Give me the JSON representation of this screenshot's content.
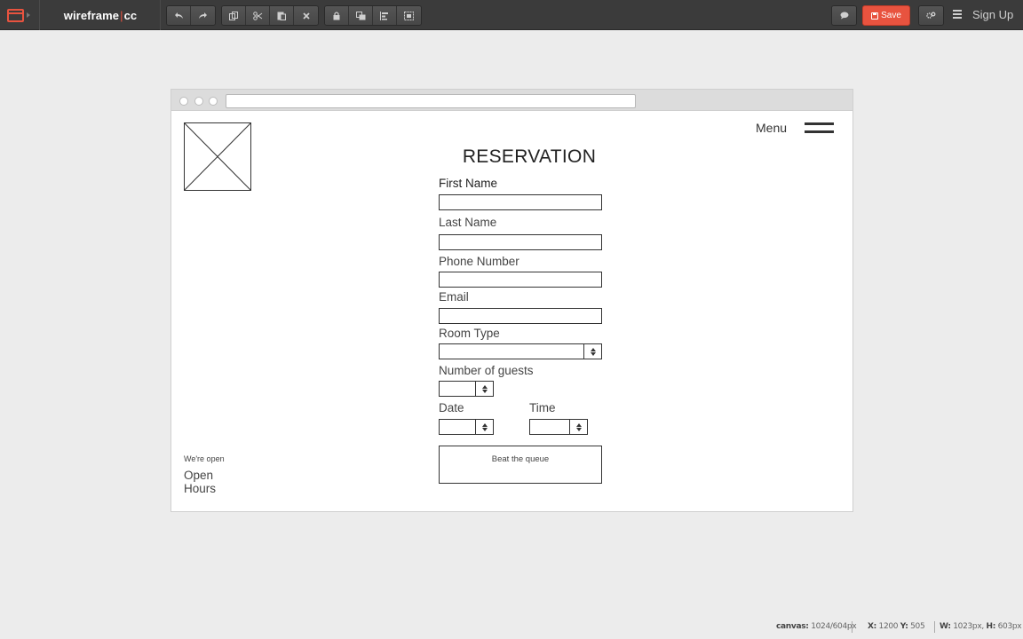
{
  "app": {
    "logo_left": "wireframe",
    "logo_sep": "|",
    "logo_right": "cc",
    "save_label": "Save",
    "signup_label": "Sign Up",
    "accent_color": "#e8533f",
    "toolbar_groups": [
      [
        "undo-icon",
        "redo-icon"
      ],
      [
        "copy-icon",
        "cut-icon",
        "paste-icon",
        "delete-icon"
      ],
      [
        "lock-icon",
        "arrange-icon",
        "align-icon",
        "group-icon"
      ],
      [
        "comment-icon"
      ],
      [
        "settings-icon"
      ]
    ]
  },
  "form": {
    "menu_label": "Menu",
    "title": "RESERVATION",
    "first_name_label": "First Name",
    "last_name_label": "Last Name",
    "phone_label": "Phone Number",
    "email_label": "Email",
    "room_type_label": "Room Type",
    "guests_label": "Number of guests",
    "date_label": "Date",
    "time_label": "Time",
    "submit_label": "Beat the queue",
    "open_small": "We're open",
    "open_hours": "Open Hours"
  },
  "status": {
    "canvas_key": "canvas:",
    "canvas_val": "1024/604px",
    "x_key": "X:",
    "x_val": "1200",
    "y_key": "Y:",
    "y_val": "505",
    "w_key": "W:",
    "w_val": "1023px,",
    "h_key": "H:",
    "h_val": "603px"
  }
}
